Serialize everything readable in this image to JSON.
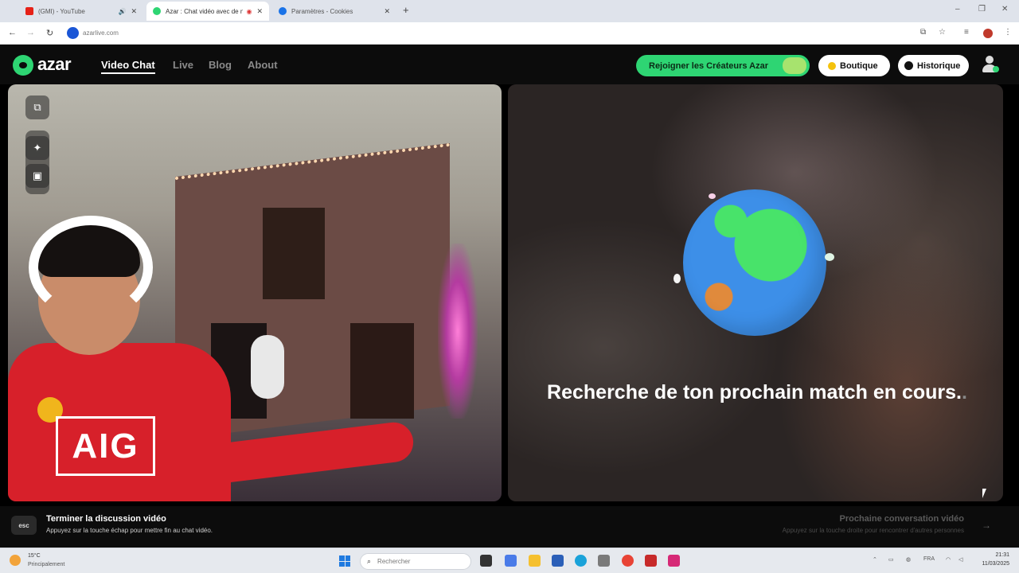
{
  "browser": {
    "tabs": [
      {
        "title": "(GMI) - YouTube",
        "favicon_color": "#e62117",
        "active": false
      },
      {
        "title": "Azar : Chat vidéo avec de n",
        "favicon_color": "#2ed573",
        "active": true
      },
      {
        "title": "Paramètres - Cookies",
        "favicon_color": "#1a73e8",
        "active": false
      }
    ],
    "new_tab_label": "+",
    "url": "azarlive.com",
    "nav_icons": {
      "back": "arrow-left-icon",
      "forward": "arrow-right-icon",
      "reload": "reload-icon"
    }
  },
  "header": {
    "logo_text": "azar",
    "nav": [
      {
        "label": "Video Chat",
        "active": true
      },
      {
        "label": "Live",
        "active": false
      },
      {
        "label": "Blog",
        "active": false
      },
      {
        "label": "About",
        "active": false
      }
    ],
    "creators_button": "Rejoigner les Créateurs Azar",
    "shop_button": "Boutique",
    "history_button": "Historique",
    "accent_color": "#2ed573"
  },
  "remote": {
    "search_message": "Recherche de ton prochain match en cours.",
    "search_dots": "."
  },
  "local_cam": {
    "shirt_text": "AIG"
  },
  "footer": {
    "esc_key": "esc",
    "end_title": "Terminer la discussion vidéo",
    "end_subtitle": "Appuyez sur la touche échap pour mettre fin au chat vidéo.",
    "next_title": "Prochaine conversation vidéo",
    "next_subtitle": "Appuyez sur la touche droite pour rencontrer d'autres personnes",
    "arrow_key": "→"
  },
  "taskbar": {
    "weather_temp": "15°C",
    "weather_desc": "Principalement",
    "search_placeholder": "Rechercher",
    "lang": "FRA",
    "time": "21:31",
    "date": "11/03/2025"
  }
}
